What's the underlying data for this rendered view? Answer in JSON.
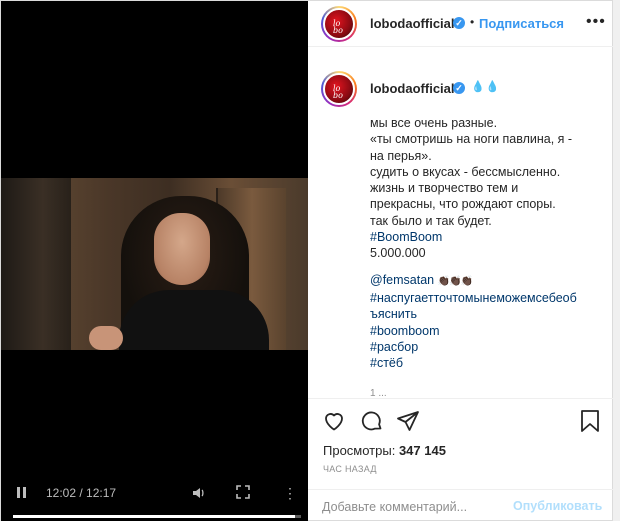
{
  "post": {
    "username": "lobodaofficial",
    "avatar_caption": "",
    "follow_label": "Подписаться",
    "header_dot": "•",
    "more_icon": "more-horizontal-icon"
  },
  "caption": {
    "username": "lobodaofficial",
    "drops": "💧💧",
    "lines": [
      "мы все очень разные.",
      "«ты смотришь на ноги павлина, я -",
      "на перья».",
      "судить о вкусах - бессмысленно.",
      "жизнь и творчество тем и",
      "прекрасны, что рождают споры.",
      "так было и так будет."
    ],
    "hashtag_boom": "#BoomBoom",
    "count": "5.000.000",
    "mention": "@femsatan",
    "clap": "👏🏿👏🏿👏🏿",
    "tags": [
      "#наспугаетточтомынеможемсебеоб",
      "ъяснить",
      "#boomboom",
      "#расбор",
      "#стёб"
    ],
    "more": "1 ..."
  },
  "video": {
    "time": "12:02 / 12:17",
    "progress": 0.98
  },
  "stats": {
    "views_label": "Просмотры:",
    "views_value": "347 145",
    "time_ago": "ЧАС НАЗАД"
  },
  "comment": {
    "placeholder": "Добавьте комментарий...",
    "publish_label": "Опубликовать"
  },
  "colors": {
    "accent": "#3897f0",
    "link": "#00376b",
    "muted": "#8e8e8e"
  }
}
